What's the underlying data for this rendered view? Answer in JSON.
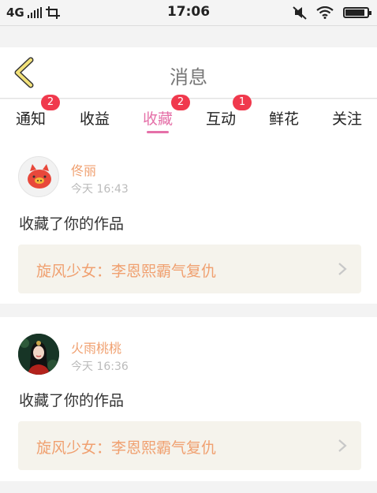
{
  "status_bar": {
    "network": "4G",
    "time": "17:06",
    "icons": [
      "signal-icon",
      "screenshot-icon",
      "mute-icon",
      "wifi-icon",
      "battery-icon"
    ],
    "battery_level": 0.9
  },
  "header": {
    "back_icon": "chevron-left-icon",
    "title": "消息"
  },
  "tabs": [
    {
      "label": "通知",
      "badge": "2",
      "active": false
    },
    {
      "label": "收益",
      "badge": "",
      "active": false
    },
    {
      "label": "收藏",
      "badge": "2",
      "active": true
    },
    {
      "label": "互动",
      "badge": "1",
      "active": false
    },
    {
      "label": "鲜花",
      "badge": "",
      "active": false
    },
    {
      "label": "关注",
      "badge": "",
      "active": false
    }
  ],
  "messages": [
    {
      "user": "佟丽",
      "time": "今天 16:43",
      "action": "收藏了你的作品",
      "work_title": "旋风少女：李恩熙霸气复仇"
    },
    {
      "user": "火雨桃桃",
      "time": "今天 16:36",
      "action": "收藏了你的作品",
      "work_title": "旋风少女：李恩熙霸气复仇"
    }
  ],
  "colors": {
    "accent": "#e570a8",
    "badge": "#f0394d",
    "username": "#f0a070",
    "link_bg": "#f5f3ec",
    "back_icon": "#f3e27a"
  }
}
